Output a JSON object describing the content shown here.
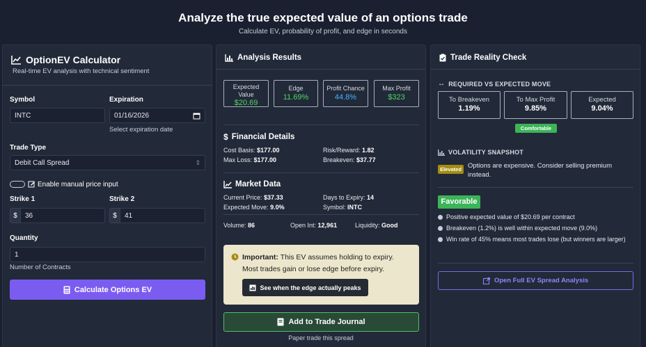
{
  "header": {
    "title": "Analyze the true expected value of an options trade",
    "subtitle": "Calculate EV, probability of profit, and edge in seconds"
  },
  "calculator": {
    "title": "OptionEV Calculator",
    "subtitle": "Real-time EV analysis with technical sentiment",
    "symbol_label": "Symbol",
    "symbol_value": "INTC",
    "expiration_label": "Expiration",
    "expiration_value": "01/16/2026",
    "expiration_hint": "Select expiration date",
    "trade_type_label": "Trade Type",
    "trade_type_value": "Debit Call Spread",
    "manual_price_label": "Enable manual price input",
    "strike1_label": "Strike 1",
    "strike1_value": "36",
    "strike2_label": "Strike 2",
    "strike2_value": "41",
    "currency_symbol": "$",
    "quantity_label": "Quantity",
    "quantity_value": "1",
    "quantity_hint": "Number of Contracts",
    "calculate_label": "Calculate Options EV"
  },
  "results": {
    "title": "Analysis Results",
    "metrics": [
      {
        "label": "Expected Value",
        "value": "$20.69"
      },
      {
        "label": "Edge",
        "value": "11.69%"
      },
      {
        "label": "Profit Chance",
        "value": "44.8%"
      },
      {
        "label": "Max Profit",
        "value": "$323"
      }
    ],
    "financial_title": "Financial Details",
    "cost_basis_label": "Cost Basis:",
    "cost_basis_value": "$177.00",
    "risk_reward_label": "Risk/Reward:",
    "risk_reward_value": "1.82",
    "max_loss_label": "Max Loss:",
    "max_loss_value": "$177.00",
    "breakeven_label": "Breakeven:",
    "breakeven_value": "$37.77",
    "market_title": "Market Data",
    "current_price_label": "Current Price:",
    "current_price_value": "$37.33",
    "days_label": "Days to Expiry:",
    "days_value": "14",
    "expected_move_label": "Expected Move:",
    "expected_move_value": "9.0%",
    "symbol_label": "Symbol:",
    "symbol_value": "INTC",
    "volume_label": "Volume:",
    "volume_value": "86",
    "open_int_label": "Open Int:",
    "open_int_value": "12,961",
    "liquidity_label": "Liquidity:",
    "liquidity_value": "Good",
    "important_label": "Important:",
    "important_text": "This EV assumes holding to expiry.",
    "important_text2": "Most trades gain or lose edge before expiry.",
    "peak_button": "See when the edge actually peaks",
    "journal_button": "Add to Trade Journal",
    "journal_hint": "Paper trade this spread"
  },
  "reality": {
    "title": "Trade Reality Check",
    "required_label": "REQUIRED VS EXPECTED MOVE",
    "boxes": [
      {
        "label": "To Breakeven",
        "value": "1.19%"
      },
      {
        "label": "To Max Profit",
        "value": "9.85%"
      },
      {
        "label": "Expected",
        "value": "9.04%"
      }
    ],
    "comfort_badge": "Comfortable",
    "volatility_label": "VOLATILITY SNAPSHOT",
    "elevated_badge": "Elevated",
    "volatility_text": "Options are expensive. Consider selling premium",
    "volatility_text2": "instead.",
    "verdict": "Favorable",
    "bullets": [
      "Positive expected value of $20.69 per contract",
      "Breakeven (1.2%) is well within expected move (9.0%)",
      "Win rate of 45% means most trades lose (but winners are larger)"
    ],
    "full_analysis_button": "Open Full EV Spread Analysis"
  },
  "colors": {
    "accent": "#7b5cf0",
    "positive": "#4cd964",
    "info": "#3fb6ff",
    "negative": "#ff5a5a"
  }
}
